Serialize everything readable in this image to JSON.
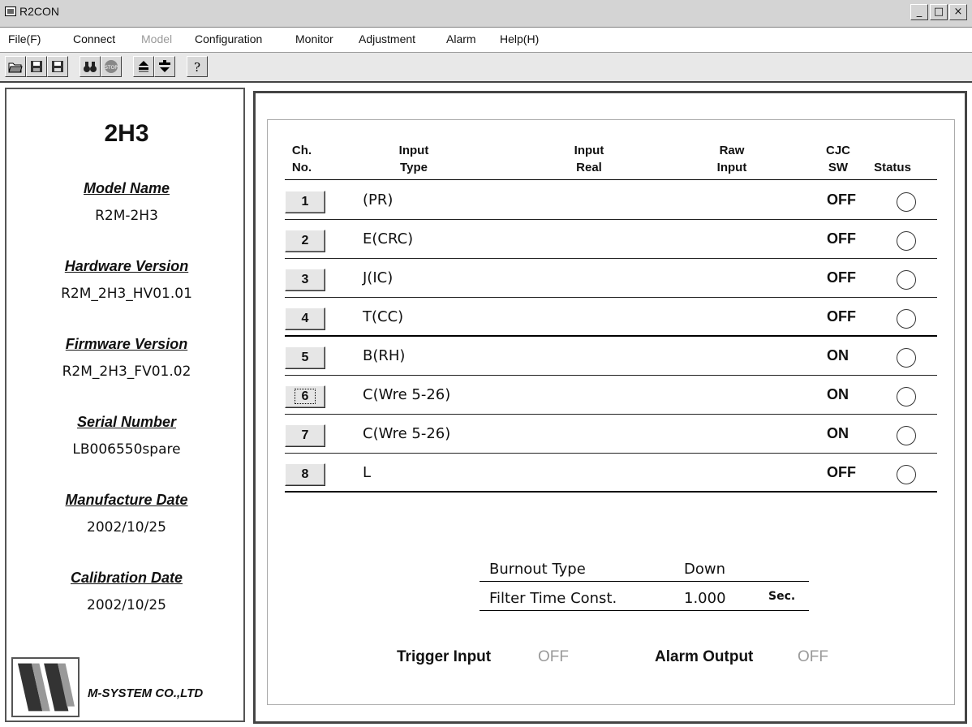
{
  "window": {
    "title": "R2CON",
    "controls": [
      "_",
      "□",
      "×"
    ]
  },
  "menu": [
    {
      "label": "File(F)",
      "enabled": true
    },
    {
      "label": "Connect",
      "enabled": true
    },
    {
      "label": "Model",
      "enabled": false
    },
    {
      "label": "Configuration",
      "enabled": true
    },
    {
      "label": "Monitor",
      "enabled": true
    },
    {
      "label": "Adjustment",
      "enabled": true
    },
    {
      "label": "Alarm",
      "enabled": true
    },
    {
      "label": "Help(H)",
      "enabled": true
    }
  ],
  "toolbar": {
    "icons": [
      "open-folder-icon",
      "save-icon",
      "save-as-icon",
      "find-binoculars-icon",
      "stop-icon",
      "upload-icon",
      "download-icon",
      "help-question-icon"
    ]
  },
  "left": {
    "model_code": "2H3",
    "model_name_label": "Model Name",
    "model_name": "R2M-2H3",
    "hardware_label": "Hardware Version",
    "hardware": "R2M_2H3_HV01.01",
    "firmware_label": "Firmware Version",
    "firmware": "R2M_2H3_FV01.02",
    "serial_label": "Serial Number",
    "serial": "LB006550spare",
    "manufacture_label": "Manufacture Date",
    "manufacture": "2002/10/25",
    "calibration_label": "Calibration Date",
    "calibration": "2002/10/25",
    "company": "M-SYSTEM CO.,LTD"
  },
  "table": {
    "headers": {
      "ch_1": "Ch.",
      "ch_2": "No.",
      "type_1": "Input",
      "type_2": "Type",
      "real_1": "Input",
      "real_2": "Real",
      "raw_1": "Raw",
      "raw_2": "Input",
      "cjc_1": "CJC",
      "cjc_2": "SW",
      "status": "Status"
    },
    "rows": [
      {
        "ch": "1",
        "type": "(PR)",
        "cjc": "OFF"
      },
      {
        "ch": "2",
        "type": "E(CRC)",
        "cjc": "OFF"
      },
      {
        "ch": "3",
        "type": "J(IC)",
        "cjc": "OFF"
      },
      {
        "ch": "4",
        "type": "T(CC)",
        "cjc": "OFF"
      },
      {
        "ch": "5",
        "type": "B(RH)",
        "cjc": "ON"
      },
      {
        "ch": "6",
        "type": "C(Wre 5-26)",
        "cjc": "ON"
      },
      {
        "ch": "7",
        "type": "C(Wre 5-26)",
        "cjc": "ON"
      },
      {
        "ch": "8",
        "type": "L",
        "cjc": "OFF"
      }
    ]
  },
  "settings": {
    "burnout_label": "Burnout Type",
    "burnout_value": "Down",
    "filter_label": "Filter Time Const.",
    "filter_value": "1.000",
    "filter_unit": "Sec."
  },
  "io": {
    "trigger_label": "Trigger Input",
    "trigger_value": "OFF",
    "alarm_label": "Alarm Output",
    "alarm_value": "OFF"
  }
}
